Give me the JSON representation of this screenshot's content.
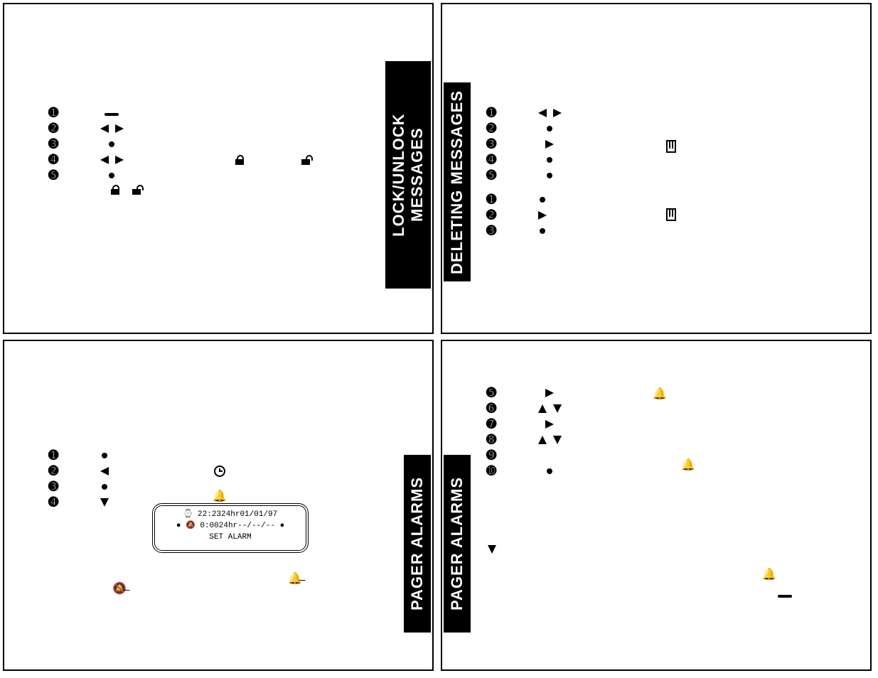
{
  "tabs": {
    "lock": "LOCK/UNLOCK MESSAGES",
    "delete": "DELETING MESSAGES",
    "alarms_left": "PAGER ALARMS",
    "alarms_right": "PAGER ALARMS"
  },
  "bullets": {
    "n1": "➊",
    "n2": "➋",
    "n3": "➌",
    "n4": "➍",
    "n5": "➎",
    "n6": "➏",
    "n7": "➐",
    "n8": "➑",
    "n9": "➒",
    "n10": "➓"
  },
  "lcd": {
    "row1_time": "22:23",
    "row1_mode": "24hr",
    "row1_date": "01/01/97",
    "row2_time": "0:00",
    "row2_mode": "24hr",
    "row2_date": "--/--/--",
    "row3": "SET ALARM"
  }
}
